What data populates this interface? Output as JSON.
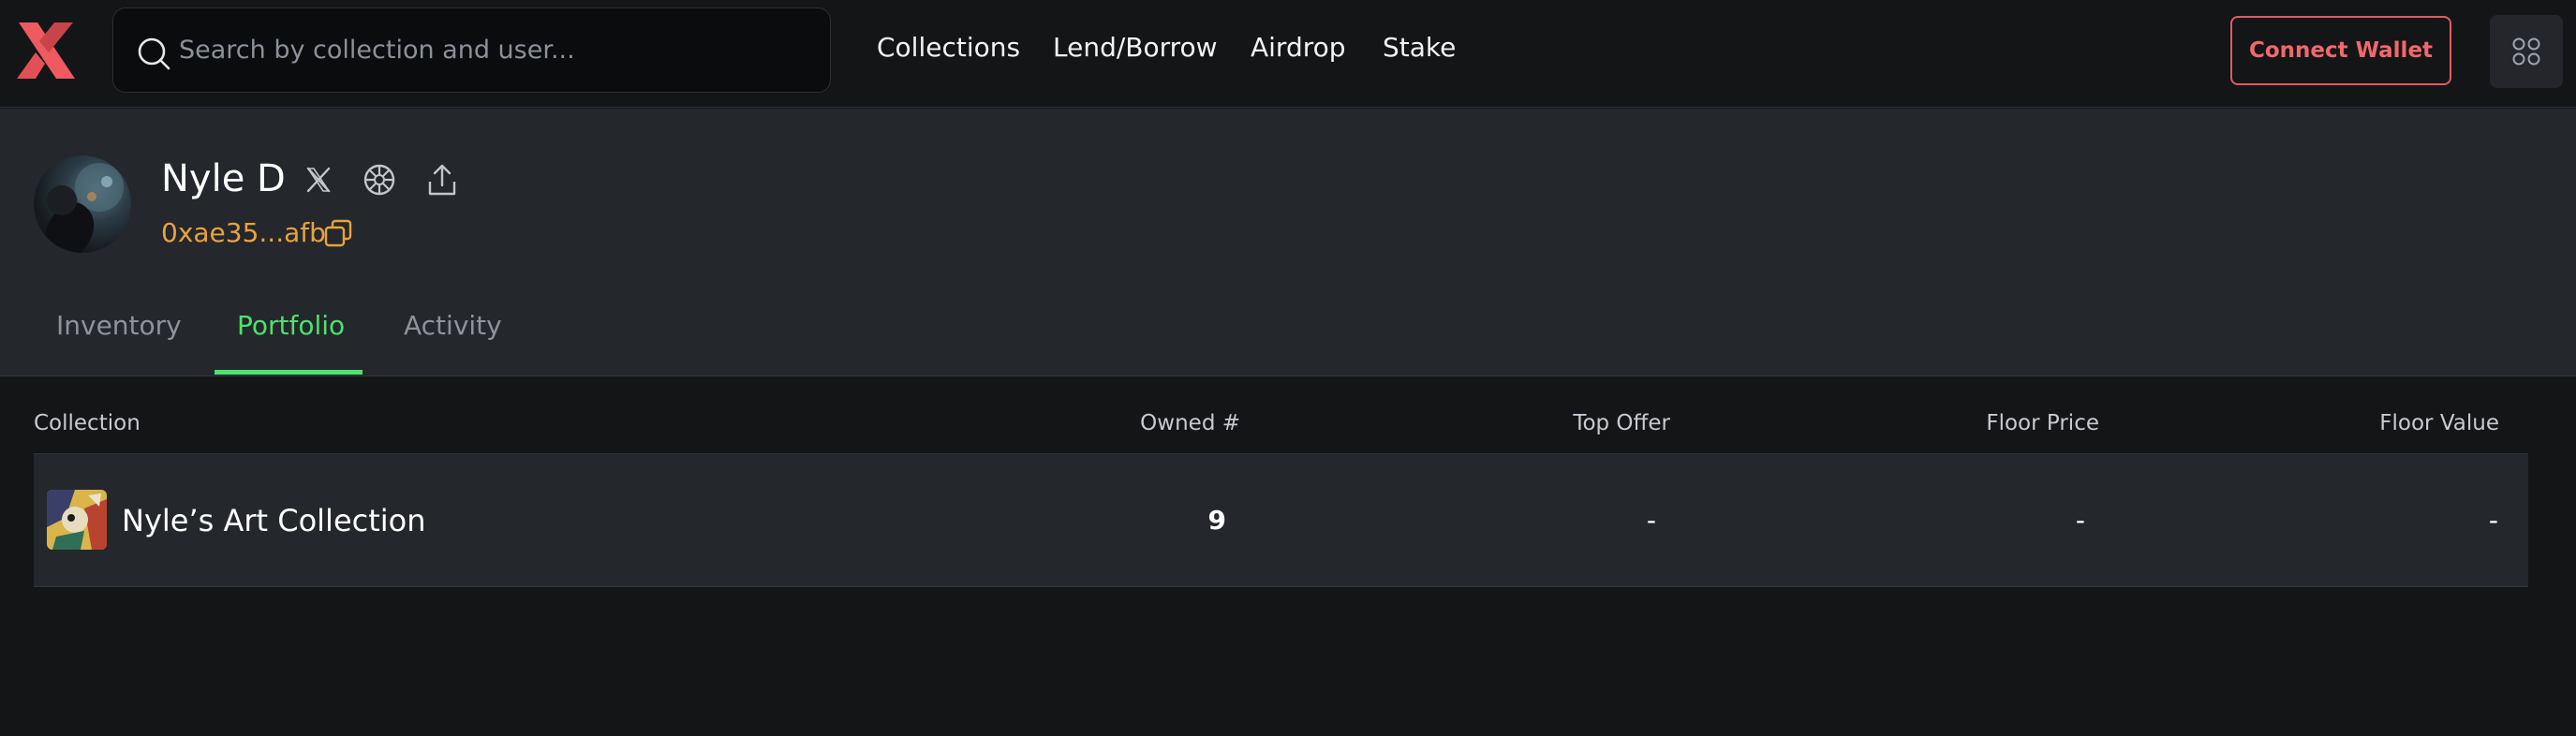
{
  "header": {
    "search_placeholder": "Search by collection and user...",
    "nav": [
      "Collections",
      "Lend/Borrow",
      "Airdrop",
      "Stake"
    ],
    "connect_label": "Connect Wallet"
  },
  "profile": {
    "name": "Nyle D",
    "address": "0xae35...afb",
    "icons": [
      "x-twitter-icon",
      "website-icon",
      "share-icon",
      "copy-icon"
    ]
  },
  "tabs": [
    {
      "label": "Inventory",
      "active": false
    },
    {
      "label": "Portfolio",
      "active": true
    },
    {
      "label": "Activity",
      "active": false
    }
  ],
  "table": {
    "columns": [
      "Collection",
      "Owned #",
      "Top Offer",
      "Floor Price",
      "Floor Value"
    ],
    "rows": [
      {
        "collection": "Nyle’s Art Collection",
        "owned": "9",
        "top_offer": "-",
        "floor_price": "-",
        "floor_value": "-"
      }
    ]
  },
  "colors": {
    "accent_green": "#4ce26b",
    "brand_red": "#e05b60",
    "address_orange": "#e8a33d"
  }
}
